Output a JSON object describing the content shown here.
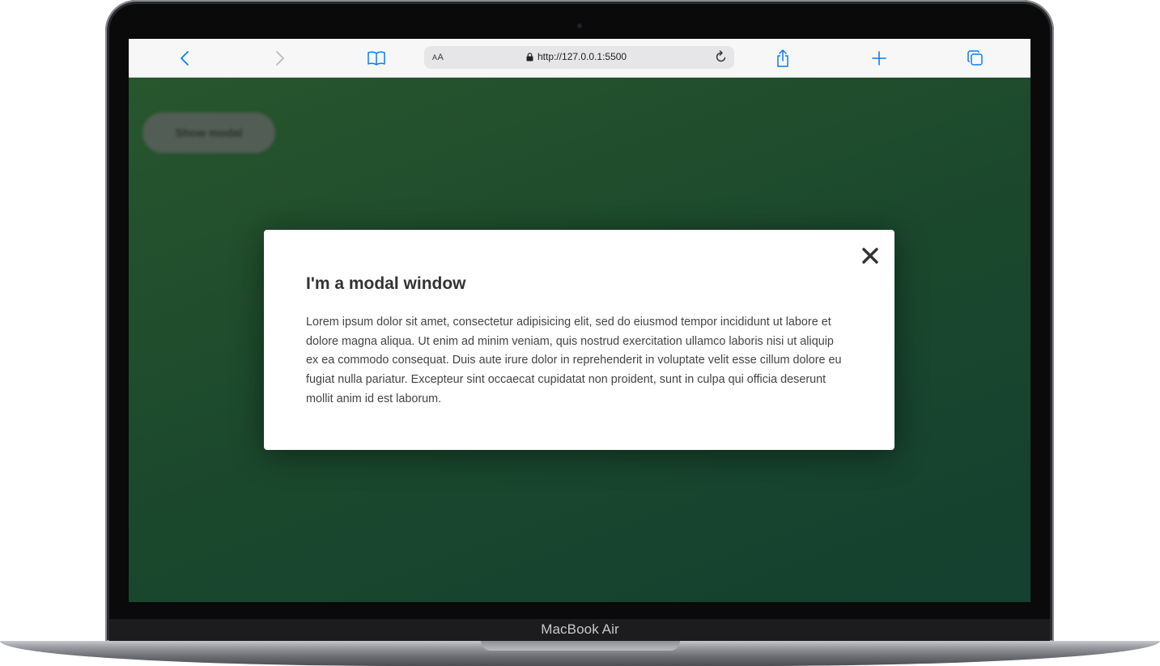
{
  "device": {
    "brand_label": "MacBook Air"
  },
  "browser": {
    "aa_label_small": "A",
    "aa_label_large": "A",
    "url": "http://127.0.0.1:5500",
    "icons": [
      "back-icon",
      "forward-icon",
      "bookmarks-icon",
      "lock-icon",
      "reload-icon",
      "share-icon",
      "new-tab-icon",
      "tabs-icon"
    ],
    "accent_color": "#0a7cff"
  },
  "page": {
    "show_modal_label": "Show modal",
    "background_colors": [
      "#2e6234",
      "#174a37"
    ]
  },
  "modal": {
    "title": "I'm a modal window",
    "body": "Lorem ipsum dolor sit amet, consectetur adipisicing elit, sed do eiusmod tempor incididunt ut labore et dolore magna aliqua. Ut enim ad minim veniam, quis nostrud exercitation ullamco laboris nisi ut aliquip ex ea commodo consequat. Duis aute irure dolor in reprehenderit in voluptate velit esse cillum dolore eu fugiat nulla pariatur. Excepteur sint occaecat cupidatat non proident, sunt in culpa qui officia deserunt mollit anim id est laborum.",
    "close_icon": "close-icon"
  }
}
